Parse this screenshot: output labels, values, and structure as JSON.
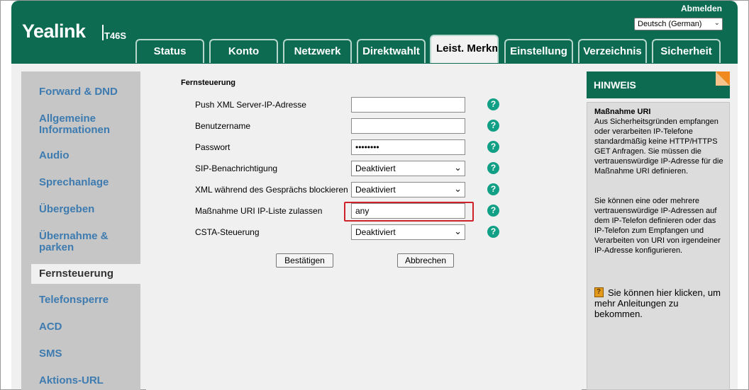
{
  "header": {
    "brand": "Yealink",
    "model": "T46S",
    "logout": "Abmelden",
    "language": "Deutsch (German)"
  },
  "tabs": [
    {
      "label": "Status"
    },
    {
      "label": "Konto"
    },
    {
      "label": "Netzwerk"
    },
    {
      "label": "Direktwahlt"
    },
    {
      "label": "Leist. Merkm"
    },
    {
      "label": "Einstellung"
    },
    {
      "label": "Verzeichnis"
    },
    {
      "label": "Sicherheit"
    }
  ],
  "sidebar": {
    "items": [
      {
        "label": "Forward & DND"
      },
      {
        "label": "Allgemeine Informationen"
      },
      {
        "label": "Audio"
      },
      {
        "label": "Sprechanlage"
      },
      {
        "label": "Übergeben"
      },
      {
        "label": "Übernahme & parken"
      },
      {
        "label": "Fernsteuerung"
      },
      {
        "label": "Telefonsperre"
      },
      {
        "label": "ACD"
      },
      {
        "label": "SMS"
      },
      {
        "label": "Aktions-URL"
      }
    ]
  },
  "form": {
    "section_title": "Fernsteuerung",
    "rows": [
      {
        "label": "Push XML Server-IP-Adresse",
        "value": ""
      },
      {
        "label": "Benutzername",
        "value": ""
      },
      {
        "label": "Passwort",
        "value": "••••••••"
      },
      {
        "label": "SIP-Benachrichtigung",
        "value": "Deaktiviert"
      },
      {
        "label": "XML während des Gesprächs blockieren",
        "value": "Deaktiviert"
      },
      {
        "label": "Maßnahme URI IP-Liste zulassen",
        "value": "any"
      },
      {
        "label": "CSTA-Steuerung",
        "value": "Deaktiviert"
      }
    ],
    "help_glyph": "?",
    "confirm_label": "Bestätigen",
    "cancel_label": "Abbrechen"
  },
  "hint": {
    "title": "HINWEIS",
    "subtitle": "Maßnahme URI",
    "paragraph1": "Aus Sicherheitsgründen empfangen oder verarbeiten IP-Telefone standardmäßig keine HTTP/HTTPS GET Anfragen. Sie müssen die vertrauenswürdige IP-Adresse für die Maßnahme URI definieren.",
    "paragraph2": "Sie können eine oder mehrere vertrauenswürdige IP-Adressen auf dem IP-Telefon definieren oder das IP-Telefon zum Empfangen und Verarbeiten von URI von irgendeiner IP-Adresse konfigurieren.",
    "link_text": "Sie können hier klicken, um mehr Anleitungen zu bekommen."
  },
  "colors": {
    "brand_green": "#0d6b52",
    "sidebar_link": "#3d7bb0",
    "help_teal": "#11a086",
    "highlight_red": "#d0202a",
    "corner_orange": "#f08a1e"
  },
  "icons": {
    "help": "question-circle-icon",
    "guide": "book-help-icon",
    "dropdown": "chevron-down-icon"
  }
}
